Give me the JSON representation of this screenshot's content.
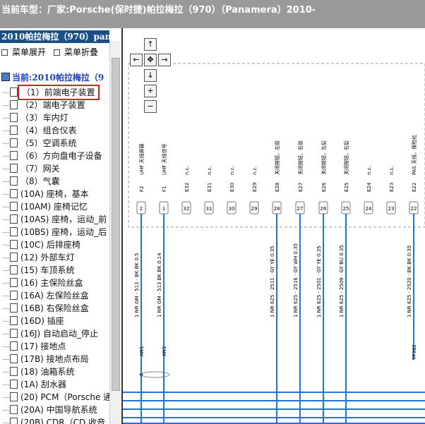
{
  "header": {
    "title": "当前车型：厂家:Porsche(保时捷)帕拉梅拉（970）（Panamera）2010-"
  },
  "sidebar": {
    "title": "2010帕拉梅拉（970）pan",
    "expand_label": "菜单展开",
    "collapse_label": "菜单折叠",
    "root_label": "当前:2010帕拉梅拉（9",
    "items": [
      {
        "label": "（1）前端电子装置",
        "selected": true
      },
      {
        "label": "（2）端电子装置"
      },
      {
        "label": "（3）车内灯"
      },
      {
        "label": "（4）组合仪表"
      },
      {
        "label": "（5）空调系统"
      },
      {
        "label": "（6）方向盘电子设备"
      },
      {
        "label": "（7）网关"
      },
      {
        "label": "（8）气囊"
      },
      {
        "label": "(10A) 座椅，基本"
      },
      {
        "label": "(10AM) 座椅记忆"
      },
      {
        "label": "(10AS) 座椅，运动_前"
      },
      {
        "label": "(10BS) 座椅，运动_后"
      },
      {
        "label": "(10C) 后排座椅"
      },
      {
        "label": "(12) 外部车灯"
      },
      {
        "label": "(15) 车顶系统"
      },
      {
        "label": "(16) 主保险丝盒"
      },
      {
        "label": "(16A) 左保险丝盒"
      },
      {
        "label": "(16B) 右保险丝盒"
      },
      {
        "label": "(16D) 插座"
      },
      {
        "label": "(16J) 自动启动_停止"
      },
      {
        "label": "(17) 接地点"
      },
      {
        "label": "(17B) 接地点布局"
      },
      {
        "label": "(18) 油箱系统"
      },
      {
        "label": "(1A) 刮水器"
      },
      {
        "label": "(20) PCM（Porsche 通"
      },
      {
        "label": "(20A) 中国导航系统"
      },
      {
        "label": "(20B) CDR（CD 收音"
      }
    ]
  },
  "diagram": {
    "pan_controls": {
      "up": "↑",
      "left": "←",
      "center": "✥",
      "right": "→",
      "down": "↓",
      "zoom_in": "+",
      "zoom_out": "−"
    },
    "pins": [
      {
        "id": "F2",
        "num": "2",
        "func": "UHF 天线屏蔽",
        "wire": "1 NR GM · 513 · BK BK 0.5",
        "label_bottom": "AN1",
        "active": true
      },
      {
        "id": "F1",
        "num": "1",
        "func": "UHF 天线信号",
        "wire": "1 NR GM · 513 BK BK 0.14",
        "label_bottom": "AN1",
        "active": true
      },
      {
        "id": "E32",
        "num": "32",
        "func": "n.c.",
        "active": false
      },
      {
        "id": "E31",
        "num": "31",
        "func": "n.c.",
        "active": false
      },
      {
        "id": "E30",
        "num": "30",
        "func": "n.c.",
        "active": false
      },
      {
        "id": "E29",
        "num": "29",
        "func": "n.c.",
        "active": false
      },
      {
        "id": "E28",
        "num": "28",
        "func": "关闭按钮，左前",
        "wire": "1 NR 625 · 2511 · GY YE 0.35",
        "active": true
      },
      {
        "id": "E27",
        "num": "27",
        "func": "关闭按钮，右前",
        "wire": "1 NR 625 · 2516 · GY WH 0.35",
        "active": true
      },
      {
        "id": "E26",
        "num": "26",
        "func": "关闭按钮，左后",
        "wire": "1 NR 625 · 2501 · GY YE 0.35",
        "active": true
      },
      {
        "id": "E25",
        "num": "25",
        "func": "关闭按钮，右后",
        "wire": "1 NR 625 · 2509 · GY BU 0.35",
        "active": true
      },
      {
        "id": "E24",
        "num": "24",
        "func": "n.c.",
        "active": false
      },
      {
        "id": "E23",
        "num": "23",
        "func": "n.c.",
        "active": false
      },
      {
        "id": "E22",
        "num": "22",
        "func": "PAS 天线，保险杠",
        "wire": "1 NR 625 · 2520 · BK BK 0.35",
        "label_bottom": "TP382",
        "active": true
      }
    ]
  },
  "colors": {
    "header_bg": "#9a9a9a",
    "sidebar_title_bg": "#1a4f86",
    "wire": "#1e73e6",
    "selection_outline": "#e01b1b"
  }
}
